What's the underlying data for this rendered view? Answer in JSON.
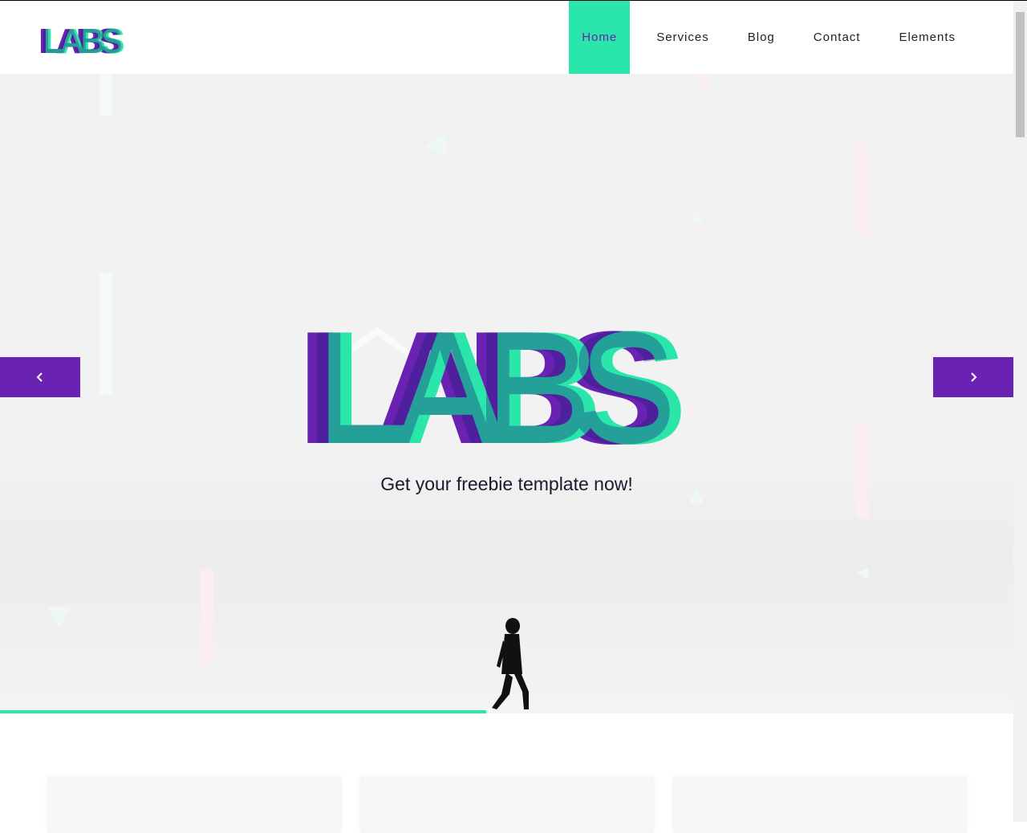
{
  "brand": {
    "logo_text": "LABS",
    "accent": "#2be6aa",
    "primary": "#6a22b3",
    "dark": "#1b1f7a"
  },
  "nav": {
    "items": [
      {
        "label": "Home",
        "active": true
      },
      {
        "label": "Services"
      },
      {
        "label": "Blog"
      },
      {
        "label": "Contact"
      },
      {
        "label": "Elements"
      }
    ]
  },
  "hero": {
    "title": "LABS",
    "tagline": "Get your freebie template now!",
    "prev_icon": "chevron-left-icon",
    "next_icon": "chevron-right-icon",
    "slide_progress": 0.48
  },
  "cards": [
    {},
    {},
    {}
  ]
}
